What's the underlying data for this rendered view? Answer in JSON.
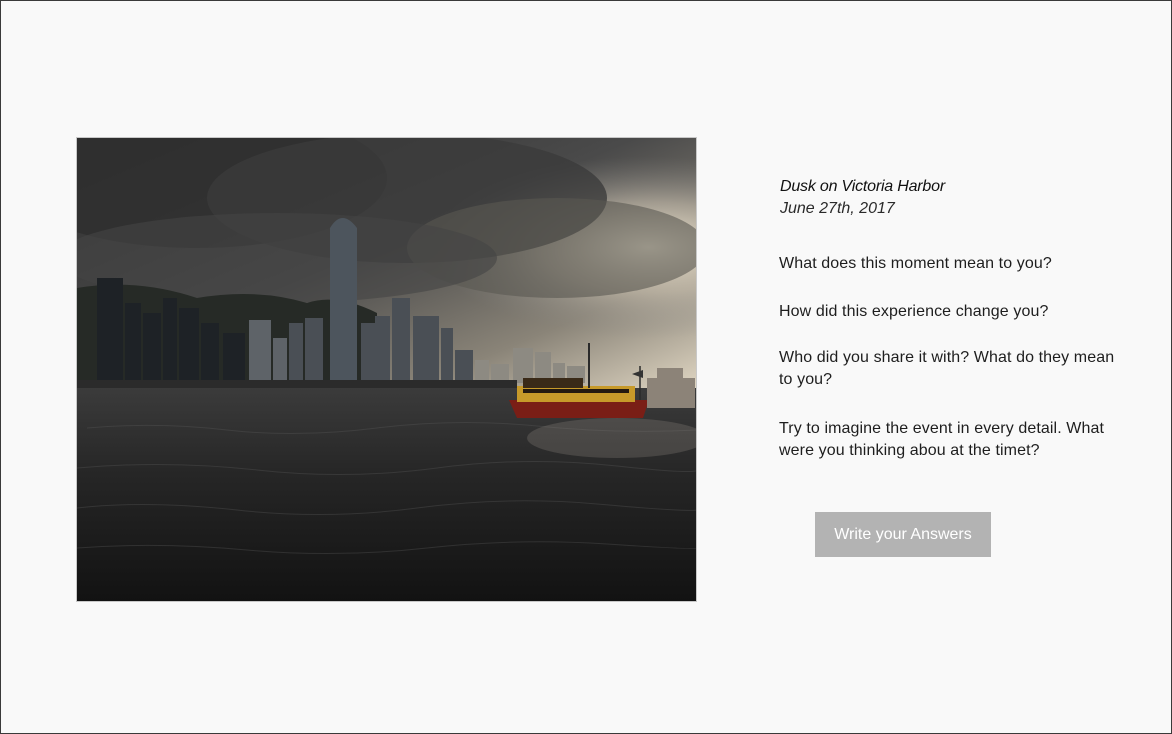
{
  "memory": {
    "title": "Dusk on Victoria Harbor",
    "date": "June 27th, 2017"
  },
  "prompts": [
    "What does this moment mean to you?",
    "How did this experience change you?",
    "Who did you share it with? What do they mean to you?",
    "Try to imagine the event in every detail. What were you thinking abou at the timet?"
  ],
  "actions": {
    "write_answers_label": "Write your Answers"
  },
  "colors": {
    "page_background": "#f9f9f9",
    "button_background": "#b3b3b3",
    "button_text": "#ffffff"
  }
}
